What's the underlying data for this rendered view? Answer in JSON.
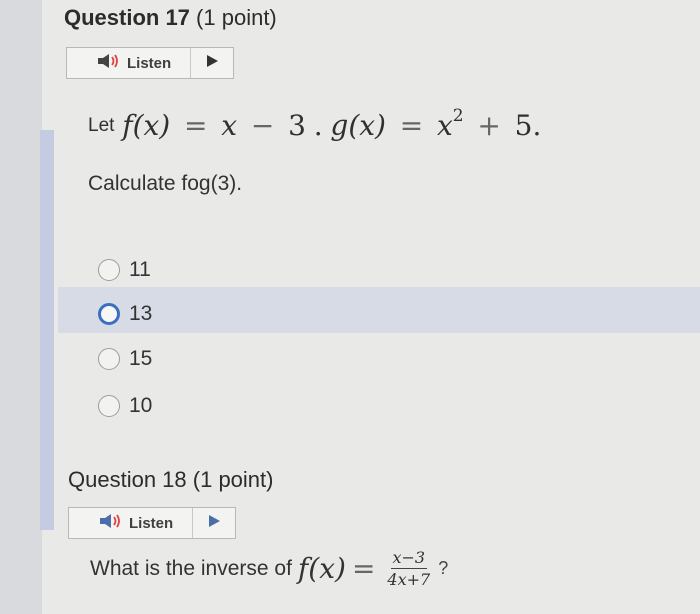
{
  "question17": {
    "title": "Question 17",
    "points": "(1 point)",
    "listen": {
      "label": "Listen",
      "speaker_icon": "speaker-icon",
      "play_icon": "play-icon"
    },
    "statement": {
      "lead": "Let",
      "f_def": {
        "func": "f",
        "arg": "(x)",
        "equals": "=",
        "rhs_var": "x",
        "rhs_op": "−",
        "rhs_const": "3"
      },
      "separator": ".",
      "g_def": {
        "func": "g",
        "arg": "(x)",
        "equals": "=",
        "rhs_var": "x",
        "rhs_exp": "2",
        "rhs_op": "+",
        "rhs_const": "5."
      }
    },
    "prompt": "Calculate fog(3).",
    "options": [
      {
        "label": "11",
        "focused": false
      },
      {
        "label": "13",
        "focused": true
      },
      {
        "label": "15",
        "focused": false
      },
      {
        "label": "10",
        "focused": false
      }
    ]
  },
  "question18": {
    "title": "Question 18",
    "points": "(1 point)",
    "listen": {
      "label": "Listen",
      "speaker_icon": "speaker-icon",
      "play_icon": "play-icon"
    },
    "text": {
      "lead": "What is the inverse of",
      "func": "f",
      "arg": "(x)",
      "equals": "=",
      "numerator": "x−3",
      "denominator": "4x+7",
      "trailing": "?"
    }
  },
  "colors": {
    "background": "#e9e9e7",
    "highlight_row": "#d6dbe6",
    "focused_radio": "#3b6fbf",
    "scrollbar": "#c5cbe0"
  }
}
